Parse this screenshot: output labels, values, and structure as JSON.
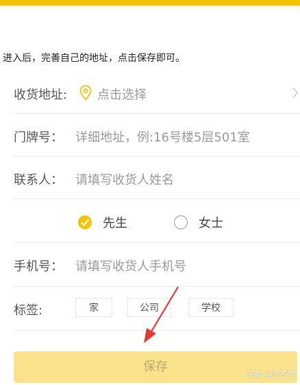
{
  "instruction": "进入后，完善自己的地址，点击保存即可。",
  "form": {
    "address": {
      "label": "收货地址:",
      "value": "点击选择"
    },
    "door": {
      "label": "门牌号：",
      "placeholder": "详细地址，例:16号楼5层501室"
    },
    "contact": {
      "label": "联系人：",
      "placeholder": "请填写收货人姓名"
    },
    "gender": {
      "options": [
        {
          "label": "先生",
          "checked": true
        },
        {
          "label": "女士",
          "checked": false
        }
      ]
    },
    "phone": {
      "label": "手机号：",
      "placeholder": "请填写收货人手机号"
    },
    "tags": {
      "label": "标签:",
      "items": [
        "家",
        "公司",
        "学校"
      ]
    }
  },
  "save_label": "保存",
  "watermark": "头条 @汪不学",
  "colors": {
    "accent": "#f7c200",
    "save_button_bg": "#fbe38e",
    "annotation": "#e53935"
  },
  "icons": {
    "address": "location-pin-icon",
    "chevron": "chevron-right-icon",
    "radio_checked": "check-circle-icon",
    "radio_unchecked": "radio-empty-icon"
  }
}
